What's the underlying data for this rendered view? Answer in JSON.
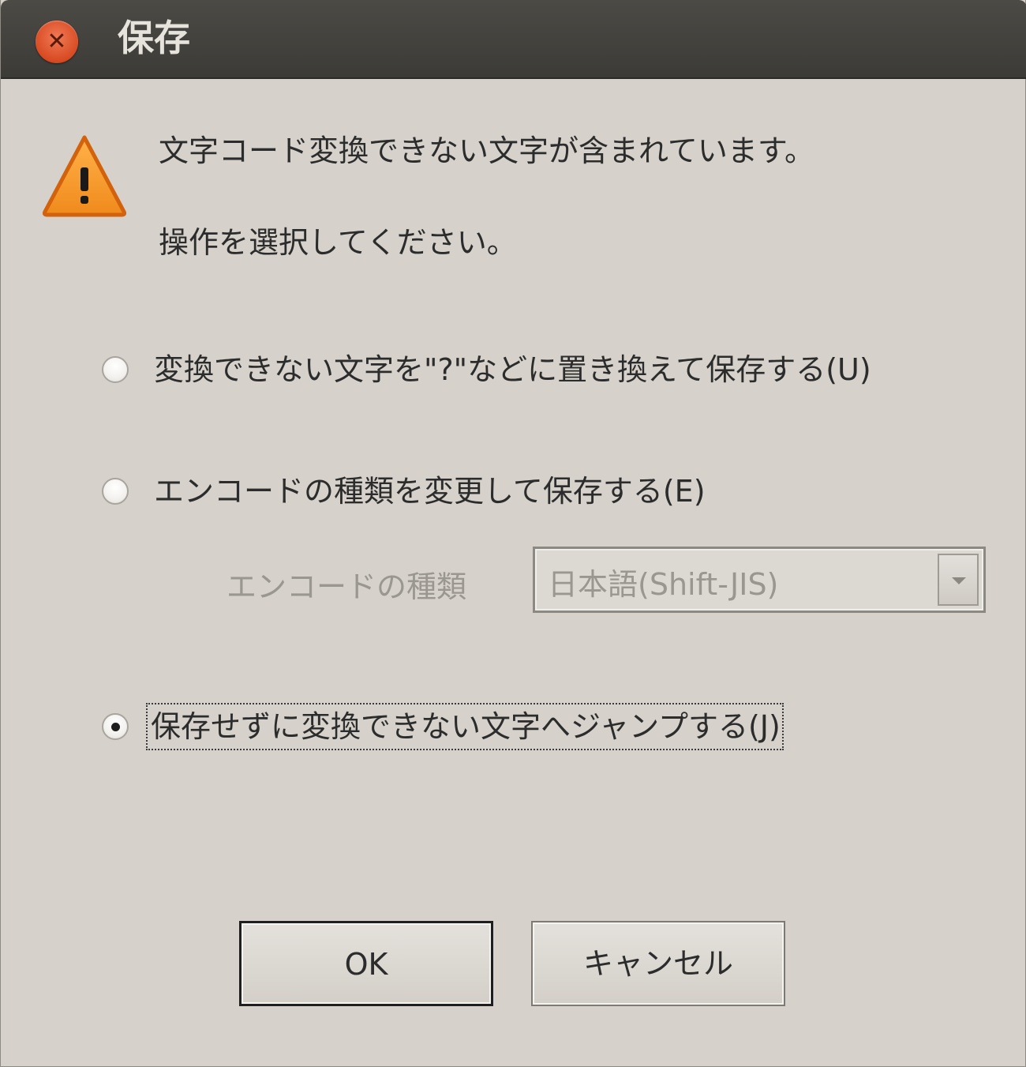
{
  "window": {
    "title": "保存"
  },
  "titlebar": {
    "close_glyph": "✕"
  },
  "message": {
    "line1": "文字コード変換できない文字が含まれています。",
    "line2": "操作を選択してください。"
  },
  "options": [
    {
      "label": "変換できない文字を\"?\"などに置き換えて保存する(U)",
      "checked": false
    },
    {
      "label": "エンコードの種類を変更して保存する(E)",
      "checked": false
    },
    {
      "label": "保存せずに変換できない文字へジャンプする(J)",
      "checked": true
    }
  ],
  "encoding": {
    "label": "エンコードの種類",
    "selected": "日本語(Shift-JIS)",
    "enabled": false
  },
  "buttons": {
    "ok": "OK",
    "cancel": "キャンセル"
  },
  "colors": {
    "titlebar": "#3c3b37",
    "background": "#d6d2cb",
    "close_button": "#d84a22",
    "warning": "#f08a1c"
  }
}
